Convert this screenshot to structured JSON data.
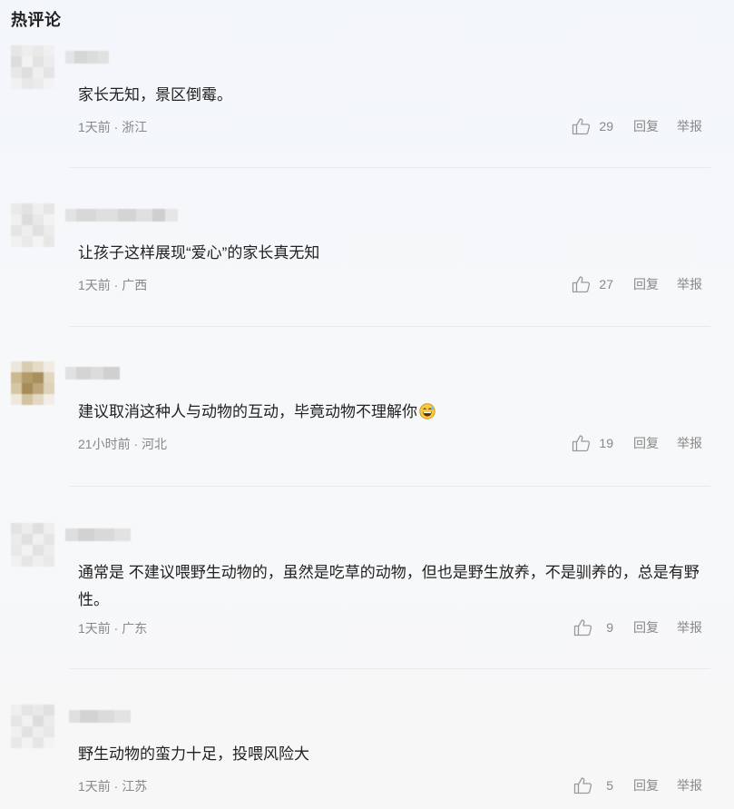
{
  "section": {
    "title": "热评论"
  },
  "comments": [
    {
      "text": "家长无知，景区倒霉。",
      "time_loc": "1天前 · 浙江",
      "likes": "29",
      "reply": "回复",
      "report": "举报"
    },
    {
      "text": "让孩子这样展现“爱心”的家长真无知",
      "time_loc": "1天前 · 广西",
      "likes": "27",
      "reply": "回复",
      "report": "举报"
    },
    {
      "text": "建议取消这种人与动物的互动，毕竟动物不理解你",
      "emoji": "grinning-sweat-emoji",
      "time_loc": "21小时前 · 河北",
      "likes": "19",
      "reply": "回复",
      "report": "举报"
    },
    {
      "text": "通常是 不建议喂野生动物的，虽然是吃草的动物，但也是野生放养，不是驯养的，总是有野性。",
      "time_loc": "1天前 · 广东",
      "likes": "9",
      "reply": "回复",
      "report": "举报"
    },
    {
      "text": "野生动物的蛮力十足，投喂风险大",
      "time_loc": "1天前 · 江苏",
      "likes": "5",
      "reply": "回复",
      "report": "举报"
    }
  ],
  "icons": {
    "like": "thumbs-up-icon",
    "avatar": "blurred-avatar"
  },
  "colors": {
    "text": "#222222",
    "meta": "#888888",
    "divider": "#e7e9ee"
  }
}
